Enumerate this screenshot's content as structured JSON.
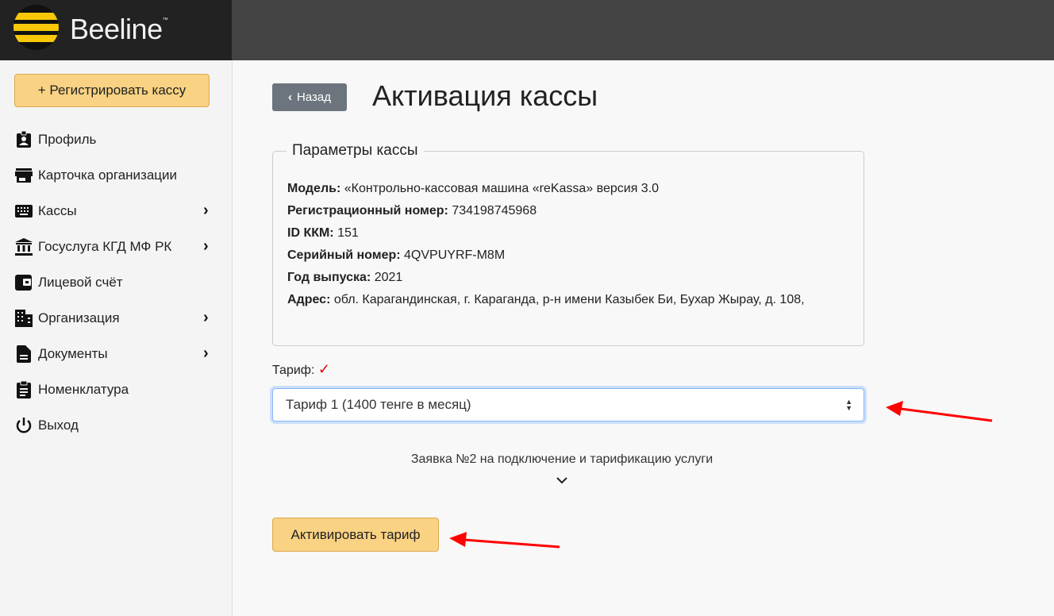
{
  "header": {
    "logo_text": "Beeline",
    "logo_tm": "™"
  },
  "sidebar": {
    "register_button": "+ Регистрировать кассу",
    "items": [
      {
        "label": "Профиль",
        "icon": "profile-badge-icon",
        "has_submenu": false
      },
      {
        "label": "Карточка организации",
        "icon": "store-icon",
        "has_submenu": false
      },
      {
        "label": "Кассы",
        "icon": "keyboard-icon",
        "has_submenu": true
      },
      {
        "label": "Госуслуга КГД МФ РК",
        "icon": "bank-icon",
        "has_submenu": true
      },
      {
        "label": "Лицевой счёт",
        "icon": "wallet-icon",
        "has_submenu": false
      },
      {
        "label": "Организация",
        "icon": "building-icon",
        "has_submenu": true
      },
      {
        "label": "Документы",
        "icon": "document-icon",
        "has_submenu": true
      },
      {
        "label": "Номенклатура",
        "icon": "clipboard-icon",
        "has_submenu": false
      },
      {
        "label": "Выход",
        "icon": "power-icon",
        "has_submenu": false
      }
    ]
  },
  "main": {
    "back_button": "Назад",
    "title": "Активация кассы",
    "params": {
      "legend": "Параметры кассы",
      "rows": [
        {
          "label": "Модель:",
          "value": "«Контрольно-кассовая машина «reKassa» версия 3.0"
        },
        {
          "label": "Регистрационный номер:",
          "value": "734198745968"
        },
        {
          "label": "ID ККМ:",
          "value": "151"
        },
        {
          "label": "Серийный номер:",
          "value": "4QVPUYRF-M8M"
        },
        {
          "label": "Год выпуска:",
          "value": "2021"
        },
        {
          "label": "Адрес:",
          "value": "обл. Карагандинская, г. Караганда, р-н имени Казыбек Би, Бухар Жырау, д. 108,"
        }
      ]
    },
    "tariff_label": "Тариф:",
    "tariff_check": "✓",
    "tariff_selected": "Тариф 1 (1400 тенге в месяц)",
    "request_text": "Заявка №2 на подключение и тарификацию услуги",
    "activate_button": "Активировать тариф"
  },
  "colors": {
    "accent": "#f9d283",
    "back": "#6c757d",
    "annotation": "#ff0000"
  }
}
